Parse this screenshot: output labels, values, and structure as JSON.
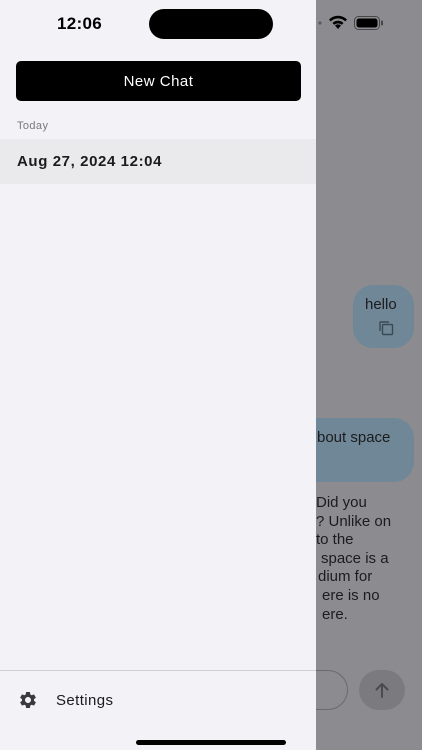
{
  "status_bar": {
    "time": "12:06"
  },
  "drawer": {
    "new_chat_label": "New Chat",
    "section_label": "Today",
    "chats": [
      {
        "label": "Aug 27, 2024 12:04"
      }
    ],
    "settings_label": "Settings"
  },
  "background_chat": {
    "user_message_1": "hello",
    "user_message_2_visible": "bout space",
    "assistant_lines": [
      "Did you",
      "? Unlike on",
      " to the",
      "space is a",
      "dium for",
      "ere is no",
      "ere."
    ]
  },
  "icons": {
    "status": [
      "wifi-icon",
      "battery-icon"
    ],
    "copy": "copy-icon",
    "send": "arrow-up-icon",
    "settings": "gear-icon"
  },
  "colors": {
    "drawer_bg": "#f2f2f7",
    "primary_button": "#000000",
    "selected_row": "#eaeaec",
    "overlay_bg": "#8c8c90",
    "user_bubble": "#6f8796"
  }
}
